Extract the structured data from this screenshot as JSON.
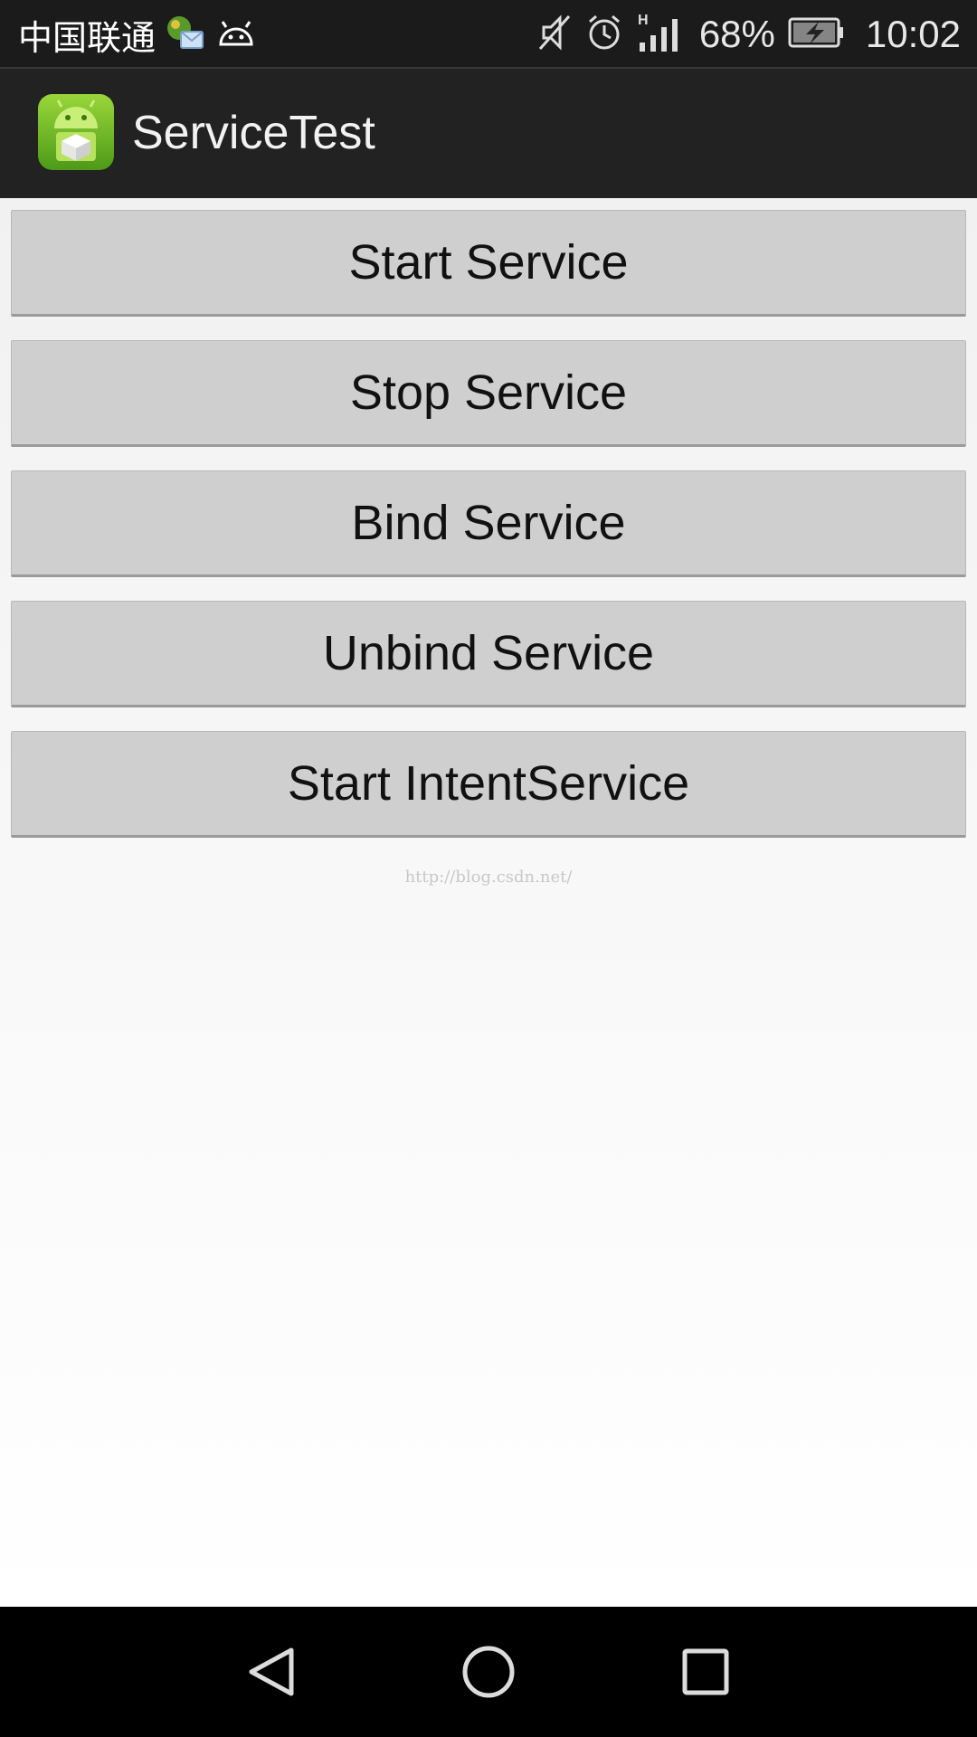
{
  "status_bar": {
    "carrier": "中国联通",
    "battery_percent": "68%",
    "clock": "10:02",
    "signal_type": "H",
    "icons": [
      "weather-mail-icon",
      "android-debug-icon",
      "mute-icon",
      "alarm-icon",
      "signal-icon",
      "battery-charging-icon"
    ]
  },
  "action_bar": {
    "title": "ServiceTest",
    "icon": "android-app-icon"
  },
  "buttons": [
    {
      "label": "Start Service"
    },
    {
      "label": "Stop Service"
    },
    {
      "label": "Bind Service"
    },
    {
      "label": "Unbind Service"
    },
    {
      "label": "Start IntentService"
    }
  ],
  "watermark": "http://blog.csdn.net/",
  "nav_bar": {
    "icons": [
      "back-icon",
      "home-icon",
      "recent-apps-icon"
    ]
  },
  "colors": {
    "status_bar": "#1b1b1b",
    "action_bar": "#222222",
    "button_bg": "#cfcfcf",
    "app_icon_green": "#7cc22a"
  }
}
